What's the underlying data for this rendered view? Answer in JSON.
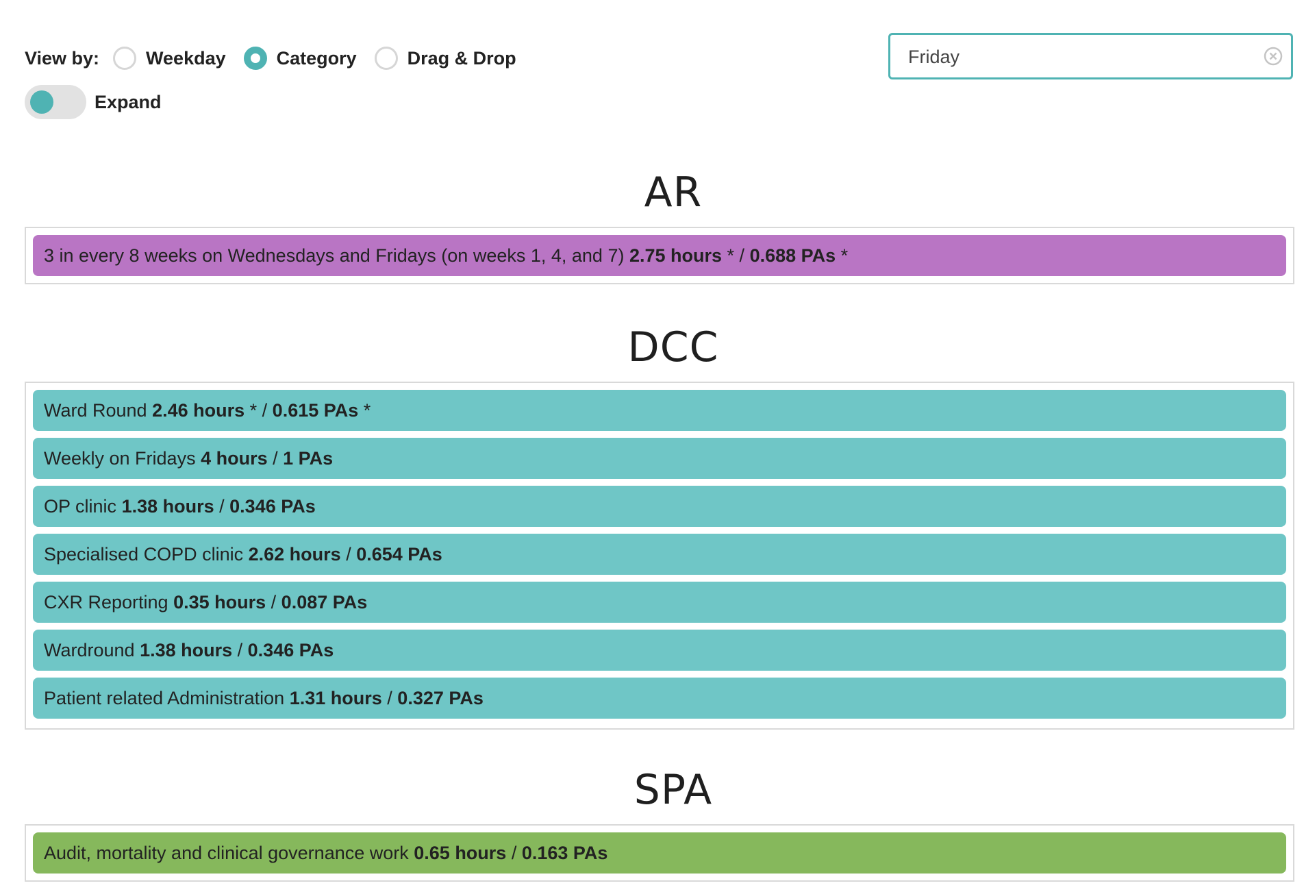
{
  "controls": {
    "view_by_label": "View by:",
    "view_options": [
      "Weekday",
      "Category",
      "Drag & Drop"
    ],
    "selected_view": "Category",
    "expand_label": "Expand",
    "expand_on": true
  },
  "search": {
    "value": "Friday"
  },
  "colors": {
    "accent": "#4fb3b3",
    "AR": "#b975c4",
    "DCC": "#6fc6c6",
    "SPA": "#86b85c"
  },
  "sections": [
    {
      "title": "AR",
      "items": [
        {
          "text": "3 in every 8 weeks on Wednesdays and Fridays (on weeks 1, 4, and 7)",
          "hours": "2.75 hours",
          "hours_suffix": " * / ",
          "pas": "0.688 PAs",
          "pas_suffix": " *"
        }
      ]
    },
    {
      "title": "DCC",
      "items": [
        {
          "text": "Ward Round",
          "hours": "2.46 hours",
          "hours_suffix": " * / ",
          "pas": "0.615 PAs",
          "pas_suffix": " *"
        },
        {
          "text": "Weekly on Fridays",
          "hours": "4 hours",
          "hours_suffix": " / ",
          "pas": "1 PAs",
          "pas_suffix": ""
        },
        {
          "text": "OP clinic",
          "hours": "1.38 hours",
          "hours_suffix": " / ",
          "pas": "0.346 PAs",
          "pas_suffix": ""
        },
        {
          "text": "Specialised COPD clinic",
          "hours": "2.62 hours",
          "hours_suffix": " / ",
          "pas": "0.654 PAs",
          "pas_suffix": ""
        },
        {
          "text": "CXR Reporting",
          "hours": "0.35 hours",
          "hours_suffix": " / ",
          "pas": "0.087 PAs",
          "pas_suffix": ""
        },
        {
          "text": "Wardround",
          "hours": "1.38 hours",
          "hours_suffix": " / ",
          "pas": "0.346 PAs",
          "pas_suffix": ""
        },
        {
          "text": "Patient related Administration",
          "hours": "1.31 hours",
          "hours_suffix": " / ",
          "pas": "0.327 PAs",
          "pas_suffix": ""
        }
      ]
    },
    {
      "title": "SPA",
      "items": [
        {
          "text": "Audit, mortality and clinical governance work",
          "hours": "0.65 hours",
          "hours_suffix": " / ",
          "pas": "0.163 PAs",
          "pas_suffix": ""
        }
      ]
    }
  ]
}
